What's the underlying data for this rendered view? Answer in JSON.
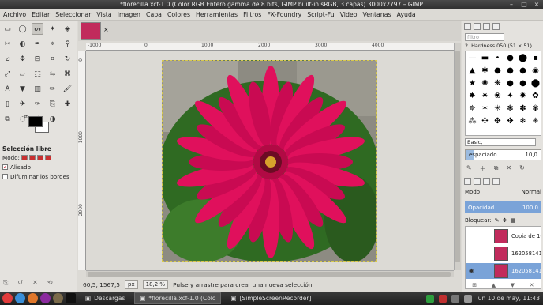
{
  "window": {
    "title": "*florecilla.xcf-1.0 (Color RGB Entero gamma de 8 bits, GIMP built-in sRGB, 3 capas) 3000x2797 – GIMP"
  },
  "menu": [
    "Archivo",
    "Editar",
    "Seleccionar",
    "Vista",
    "Imagen",
    "Capa",
    "Colores",
    "Herramientas",
    "Filtros",
    "FX-Foundry",
    "Script-Fu",
    "Video",
    "Ventanas",
    "Ayuda"
  ],
  "toolbox": {
    "tool_icons": [
      "rect-select",
      "ellipse-select",
      "free-select",
      "fuzzy-select",
      "select-by-color",
      "scissors",
      "foreground-select",
      "paths",
      "color-picker",
      "zoom",
      "measure",
      "move",
      "align",
      "crop",
      "rotate",
      "scale",
      "shear",
      "perspective",
      "flip",
      "cage",
      "text",
      "bucket-fill",
      "blend",
      "pencil",
      "paintbrush",
      "eraser",
      "airbrush",
      "ink",
      "clone",
      "heal",
      "perspective-clone",
      "blur",
      "smudge",
      "dodge-burn"
    ],
    "options_title": "Selección libre",
    "mode_label": "Modo:",
    "antialias_label": "Alisado",
    "antialias_checked": true,
    "feather_label": "Difuminar los bordes",
    "feather_checked": false
  },
  "rulers": {
    "top": [
      "-1000",
      "0",
      "1000",
      "2000",
      "3000",
      "4000"
    ],
    "left": [
      "0",
      "1000",
      "2000"
    ]
  },
  "statusbar": {
    "coords": "60,5, 1567,5",
    "unit": "px",
    "zoom": "18,2 %",
    "message": "Pulse y arrastre para crear una nueva selección"
  },
  "dock": {
    "filter_placeholder": "filtro",
    "brush_name": "2. Hardness 050 (51 × 51)",
    "preset": "Basic,",
    "spacing_label": "espaciado",
    "spacing_value": "10,0",
    "spacing_fraction": 0.1,
    "mode_label": "Modo",
    "mode_value": "Normal",
    "opacity_label": "Opacidad",
    "opacity_value": "100,0",
    "lock_label": "Bloquear:",
    "layers": [
      {
        "name": "Copia de 1620",
        "selected": false,
        "visible": false
      },
      {
        "name": "16205814192",
        "selected": false,
        "visible": false
      },
      {
        "name": "16205814192",
        "selected": true,
        "visible": true
      }
    ]
  },
  "taskbar": {
    "items": [
      "Descargas",
      "*florecilla.xcf-1.0 (Colo",
      "[SimpleScreenRecorder]"
    ],
    "active_index": 1,
    "clock": "lun 10 de may, 11:43"
  },
  "colors": {
    "accent": "#7aa3d8",
    "flower": "#e0105c",
    "foreground": "#000000",
    "background": "#ffffff"
  }
}
